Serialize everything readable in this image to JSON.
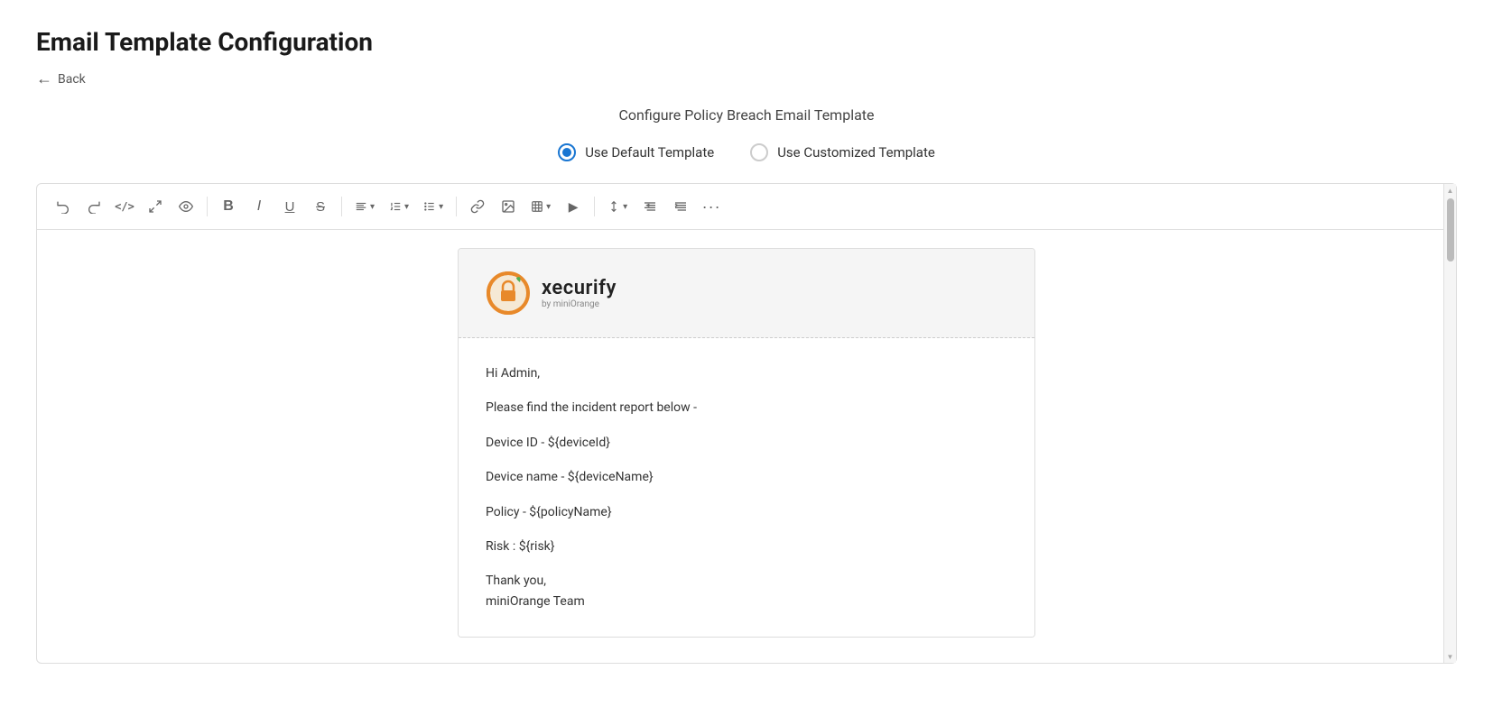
{
  "page": {
    "title": "Email Template Configuration",
    "back_label": "Back",
    "section_title": "Configure Policy Breach Email Template"
  },
  "template_options": {
    "default": {
      "label": "Use Default Template",
      "selected": true
    },
    "customized": {
      "label": "Use Customized Template",
      "selected": false
    }
  },
  "toolbar": {
    "buttons": [
      {
        "name": "undo",
        "icon": "↩",
        "label": "Undo"
      },
      {
        "name": "redo",
        "icon": "↪",
        "label": "Redo"
      },
      {
        "name": "code",
        "icon": "</>",
        "label": "Code"
      },
      {
        "name": "fullscreen",
        "icon": "⛶",
        "label": "Fullscreen"
      },
      {
        "name": "preview",
        "icon": "👁",
        "label": "Preview"
      },
      {
        "name": "bold",
        "icon": "B",
        "label": "Bold"
      },
      {
        "name": "italic",
        "icon": "I",
        "label": "Italic"
      },
      {
        "name": "underline",
        "icon": "U",
        "label": "Underline"
      },
      {
        "name": "strikethrough",
        "icon": "S",
        "label": "Strikethrough"
      },
      {
        "name": "align",
        "icon": "≡",
        "label": "Align",
        "has_arrow": true
      },
      {
        "name": "ordered-list",
        "icon": "≡",
        "label": "Ordered List",
        "has_arrow": true
      },
      {
        "name": "unordered-list",
        "icon": "≡",
        "label": "Unordered List",
        "has_arrow": true
      },
      {
        "name": "link",
        "icon": "🔗",
        "label": "Link"
      },
      {
        "name": "image",
        "icon": "🖼",
        "label": "Image"
      },
      {
        "name": "table",
        "icon": "⊞",
        "label": "Table",
        "has_arrow": true
      },
      {
        "name": "media",
        "icon": "▶",
        "label": "Media"
      },
      {
        "name": "line-height",
        "icon": "↕",
        "label": "Line Height",
        "has_arrow": true
      },
      {
        "name": "outdent",
        "icon": "⇤",
        "label": "Outdent"
      },
      {
        "name": "indent",
        "icon": "⇥",
        "label": "Indent"
      },
      {
        "name": "more",
        "icon": "•••",
        "label": "More"
      }
    ]
  },
  "email_content": {
    "logo_name": "xecurify",
    "logo_tagline": "by miniOrange",
    "greeting": "Hi Admin,",
    "intro": "Please find the incident report below -",
    "device_id": "Device ID - ${deviceId}",
    "device_name": "Device name - ${deviceName}",
    "policy": "Policy - ${policyName}",
    "risk": "Risk : ${risk}",
    "closing": "Thank you,",
    "team": "miniOrange Team"
  }
}
